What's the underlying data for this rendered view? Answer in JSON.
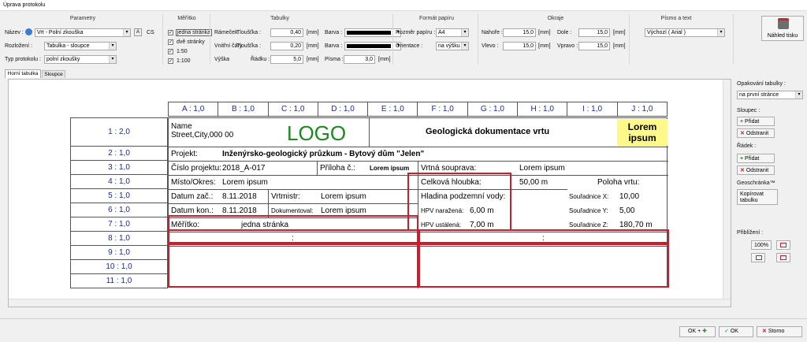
{
  "window_title": "Úprava protokolu",
  "params": {
    "title": "Parametry",
    "name_label": "Název :",
    "name_value": "Vrt - Polní zkouška",
    "lang": "CS",
    "layout_label": "Rozložení :",
    "layout_value": "Tabulka - sloupce",
    "type_label": "Typ protokolu :",
    "type_value": "polní zkoušky"
  },
  "scale": {
    "title": "Měřítko",
    "options": [
      {
        "label": "jedna stránka",
        "checked": true
      },
      {
        "label": "dvě stránky",
        "checked": true
      },
      {
        "label": "1:50",
        "checked": true
      },
      {
        "label": "1:100",
        "checked": true
      }
    ]
  },
  "tables": {
    "title": "Tabulky",
    "frame_label": "Rámeček",
    "inner_label": "Vnitřní čáry",
    "height_label": "Výška",
    "thickness_label": "Tloušťka :",
    "frame_thickness": "0,40",
    "inner_thickness": "0,20",
    "rows_label": "Řádku :",
    "rows_value": "5,0",
    "unit_mm": "[mm]",
    "color_label": "Barva :",
    "font_label": "Písma :",
    "font_value": "3,0"
  },
  "paper": {
    "title": "Formát papíru",
    "size_label": "Rozměr papíru :",
    "size_value": "A4",
    "orient_label": "Orientace :",
    "orient_value": "na výšku"
  },
  "margins": {
    "title": "Okraje",
    "top_label": "Nahoře :",
    "top_value": "15,0",
    "bottom_label": "Dole :",
    "bottom_value": "15,0",
    "left_label": "Vlevo :",
    "left_value": "15,0",
    "right_label": "Vpravo :",
    "right_value": "15,0",
    "unit": "[mm]"
  },
  "font": {
    "title": "Písmo a text",
    "value": "Výchozí ( Arial )"
  },
  "preview_button": "Náhled tisku",
  "tabs": [
    "Horní tabulka",
    "Sloupce"
  ],
  "grid": {
    "col_headers": [
      "A : 1,0",
      "B : 1,0",
      "C : 1,0",
      "D : 1,0",
      "E : 1,0",
      "F : 1,0",
      "G : 1,0",
      "H : 1,0",
      "I : 1,0",
      "J : 1,0"
    ],
    "row_headers": [
      "1 : 2,0",
      "2 : 1,0",
      "3 : 1,0",
      "4 : 1,0",
      "5 : 1,0",
      "6 : 1,0",
      "7 : 1,0",
      "8 : 1,0",
      "9 : 1,0",
      "10 : 1,0",
      "11 : 1,0"
    ],
    "r1_name": "Name",
    "r1_addr": "Street,City,000 00",
    "logo": "LOGO",
    "doc_title": "Geologická dokumentace vrtu",
    "lorem_box": "Lorem ipsum",
    "project_label": "Projekt:",
    "project_value": "Inženýrsko-geologický průzkum - Bytový dům \"Jelen\"",
    "projnum_label": "Číslo projektu:",
    "projnum_value": "2018_A-017",
    "annex_label": "Příloha č.:",
    "annex_value": "Lorem ipsum",
    "rig_label": "Vrtná souprava:",
    "rig_value": "Lorem ipsum",
    "place_label": "Místo/Okres:",
    "place_value": "Lorem ipsum",
    "depth_label": "Celková hloubka:",
    "depth_value": "50,00 m",
    "pos_label": "Poloha vrtu:",
    "start_label": "Datum zač.:",
    "start_value": "8.11.2018",
    "master_label": "Vrtmistr:",
    "master_value": "Lorem ipsum",
    "gw_label": "Hladina podzemní vody:",
    "x_label": "Souřadnice X:",
    "x_value": "10,00",
    "end_label": "Datum kon.:",
    "end_value": "8.11.2018",
    "doc_label": "Dokumentoval:",
    "doc_value": "Lorem ipsum",
    "hpv1_label": "HPV naražená:",
    "hpv1_value": "6,00 m",
    "y_label": "Souřadnice Y:",
    "y_value": "5,00",
    "scale_label": "Měřítko:",
    "scale_value": "jedna stránka",
    "hpv2_label": "HPV ustálená:",
    "hpv2_value": "7,00 m",
    "z_label": "Souřadnice Z:",
    "z_value": "180,70 m",
    "colon": ":"
  },
  "side": {
    "repeat_label": "Opakování tabulky :",
    "repeat_value": "na první stránce",
    "col_label": "Sloupec :",
    "add": "Přidat",
    "remove": "Odstranit",
    "row_label": "Řádek :",
    "clipboard_label": "Geoschránka™",
    "copy_table": "Kopírovat tabulku",
    "zoom_label": "Přiblížení :",
    "zoom_value": "100%"
  },
  "footer": {
    "ok_plus": "OK +",
    "ok": "OK",
    "cancel": "Storno"
  }
}
